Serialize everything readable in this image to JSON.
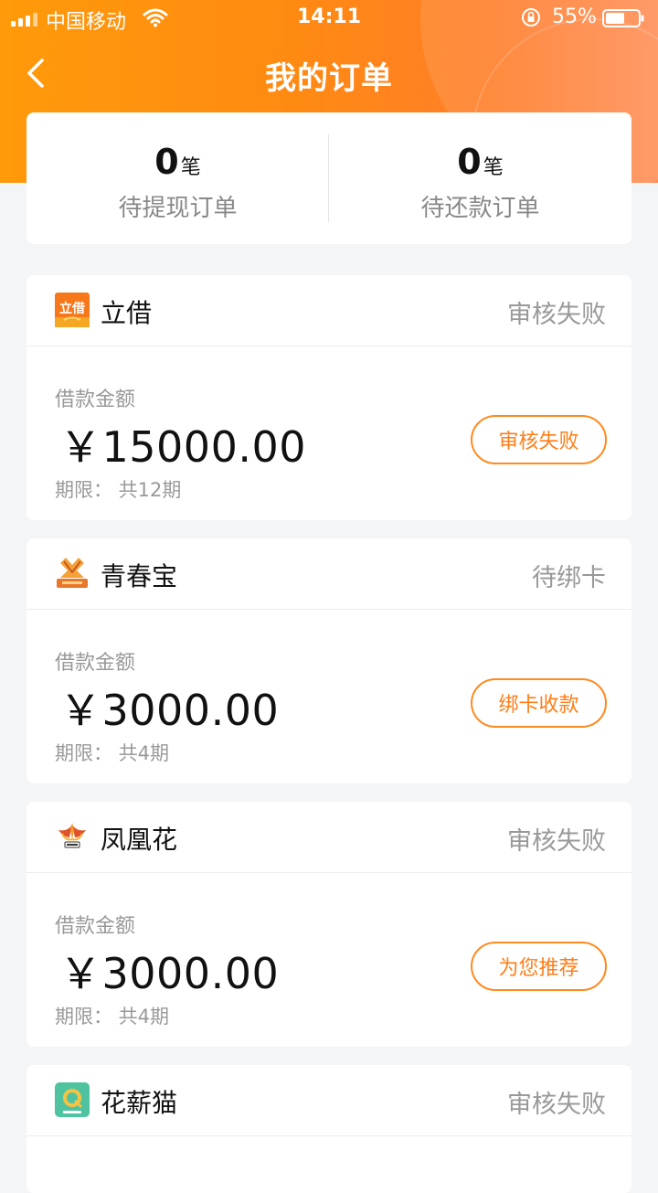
{
  "status_bar": {
    "carrier": "中国移动",
    "time": "14:11",
    "battery": "55%"
  },
  "nav": {
    "title": "我的订单"
  },
  "summary": {
    "pending_withdraw": {
      "count": "0",
      "unit": "笔",
      "label": "待提现订单"
    },
    "pending_repay": {
      "count": "0",
      "unit": "笔",
      "label": "待还款订单"
    }
  },
  "orders": [
    {
      "name": "立借",
      "status": "审核失败",
      "amount_label": "借款金额",
      "amount": "￥15000.00",
      "term": "期限：  共12期",
      "button": "审核失败",
      "logo_text": "立借"
    },
    {
      "name": "青春宝",
      "status": "待绑卡",
      "amount_label": "借款金额",
      "amount": "￥3000.00",
      "term": "期限：  共4期",
      "button": "绑卡收款"
    },
    {
      "name": "凤凰花",
      "status": "审核失败",
      "amount_label": "借款金额",
      "amount": "￥3000.00",
      "term": "期限：  共4期",
      "button": "为您推荐"
    },
    {
      "name": "花薪猫",
      "status": "审核失败"
    }
  ],
  "colors": {
    "header_start": "#ff9a0a",
    "header_end": "#ff8f58",
    "accent": "#ff8a1f",
    "background": "#f4f5f7"
  }
}
